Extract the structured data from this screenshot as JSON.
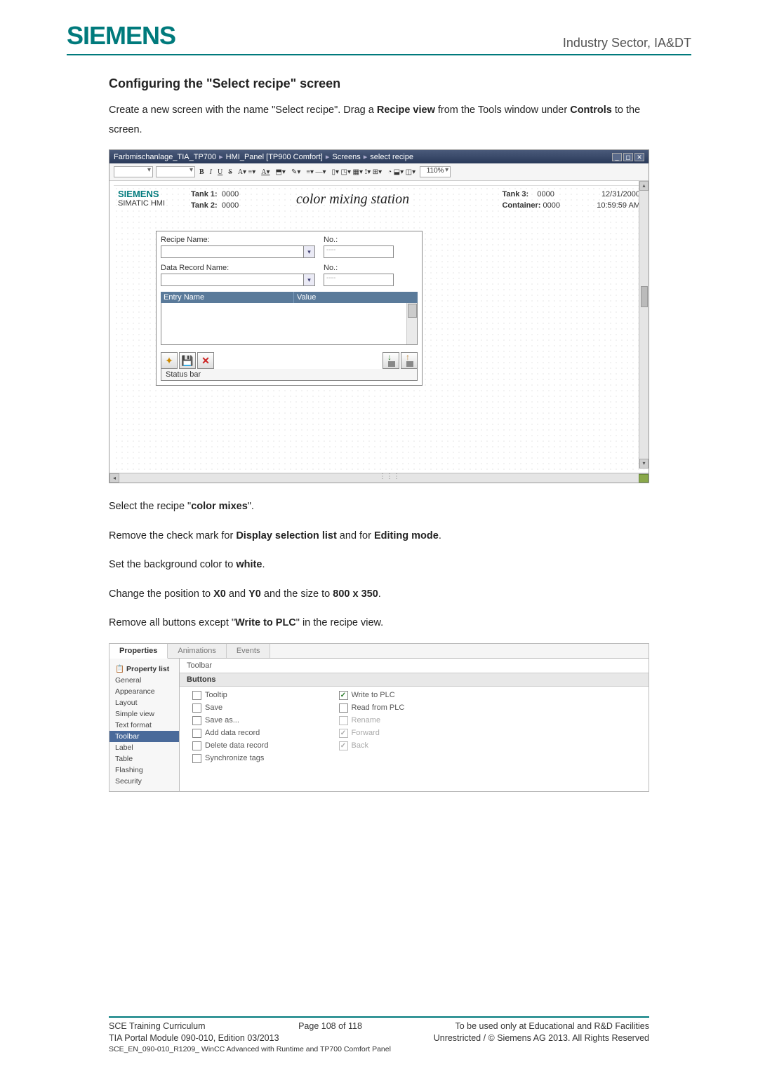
{
  "header": {
    "logo": "SIEMENS",
    "right": "Industry Sector, IA&DT"
  },
  "heading": "Configuring the \"Select recipe\" screen",
  "intro_1a": "Create a new screen with the name \"Select recipe\".  Drag a ",
  "intro_1b": "Recipe view",
  "intro_1c": " from the Tools window under ",
  "intro_1d": "Controls",
  "intro_1e": " to the screen.",
  "fig1": {
    "titlebar_parts": [
      "Farbmischanlage_TIA_TP700",
      "▸",
      "HMI_Panel [TP900 Comfort]",
      "▸",
      "Screens",
      "▸",
      "select recipe"
    ],
    "toolbar_zoom": "110%",
    "siemens_label": "SIEMENS",
    "simatic_label": "SIMATIC HMI",
    "tank1_label": "Tank 1:",
    "tank1_val": "0000",
    "tank2_label": "Tank 2:",
    "tank2_val": "0000",
    "cms_title": "color mixing station",
    "tank3_label": "Tank 3:",
    "tank3_val": "0000",
    "container_label": "Container:",
    "container_val": "0000",
    "date": "12/31/2000",
    "time": "10:59:59 AM",
    "recipe_name_label": "Recipe Name:",
    "no_label": "No.:",
    "data_record_label": "Data Record Name:",
    "no_placeholder": "----",
    "entry_name_header": "Entry Name",
    "value_header": "Value",
    "status_bar": "Status bar"
  },
  "instructions": {
    "line1a": "Select the recipe \"",
    "line1b": "color mixes",
    "line1c": "\".",
    "line2a": "Remove the check mark for ",
    "line2b": "Display selection list",
    "line2c": " and for ",
    "line2d": "Editing mode",
    "line2e": ".",
    "line3a": "Set the background color to ",
    "line3b": "white",
    "line3c": ".",
    "line4a": "Change the position to ",
    "line4b": "X0",
    "line4c": " and ",
    "line4d": "Y0",
    "line4e": " and the size to ",
    "line4f": "800 x 350",
    "line4g": ".",
    "line5a": "Remove all buttons except \"",
    "line5b": "Write to PLC",
    "line5c": "\" in the recipe view."
  },
  "fig2": {
    "tabs": [
      "Properties",
      "Animations",
      "Events"
    ],
    "nav_header": "Property list",
    "nav_items": [
      "General",
      "Appearance",
      "Layout",
      "Simple view",
      "Text format",
      "Toolbar",
      "Label",
      "Table",
      "Flashing",
      "Security"
    ],
    "nav_selected": "Toolbar",
    "section_title": "Toolbar",
    "group_title": "Buttons",
    "left_checks": [
      {
        "label": "Tooltip",
        "checked": false,
        "disabled": false
      },
      {
        "label": "Save",
        "checked": false,
        "disabled": false
      },
      {
        "label": "Save as...",
        "checked": false,
        "disabled": false
      },
      {
        "label": "Add data record",
        "checked": false,
        "disabled": false
      },
      {
        "label": "Delete data record",
        "checked": false,
        "disabled": false
      },
      {
        "label": "Synchronize tags",
        "checked": false,
        "disabled": false
      }
    ],
    "right_checks": [
      {
        "label": "Write to PLC",
        "checked": true,
        "disabled": false
      },
      {
        "label": "Read from PLC",
        "checked": false,
        "disabled": false
      },
      {
        "label": "Rename",
        "checked": false,
        "disabled": true
      },
      {
        "label": "Forward",
        "checked": true,
        "disabled": true
      },
      {
        "label": "Back",
        "checked": true,
        "disabled": true
      }
    ]
  },
  "footer": {
    "left1": "SCE Training Curriculum",
    "mid1": "Page 108 of 118",
    "right1": "To be used only at Educational and R&D Facilities",
    "left2": "TIA Portal Module 090-010, Edition 03/2013",
    "right2": "Unrestricted / © Siemens AG 2013. All Rights Reserved",
    "small": "SCE_EN_090-010_R1209_ WinCC Advanced with Runtime and TP700 Comfort Panel"
  }
}
